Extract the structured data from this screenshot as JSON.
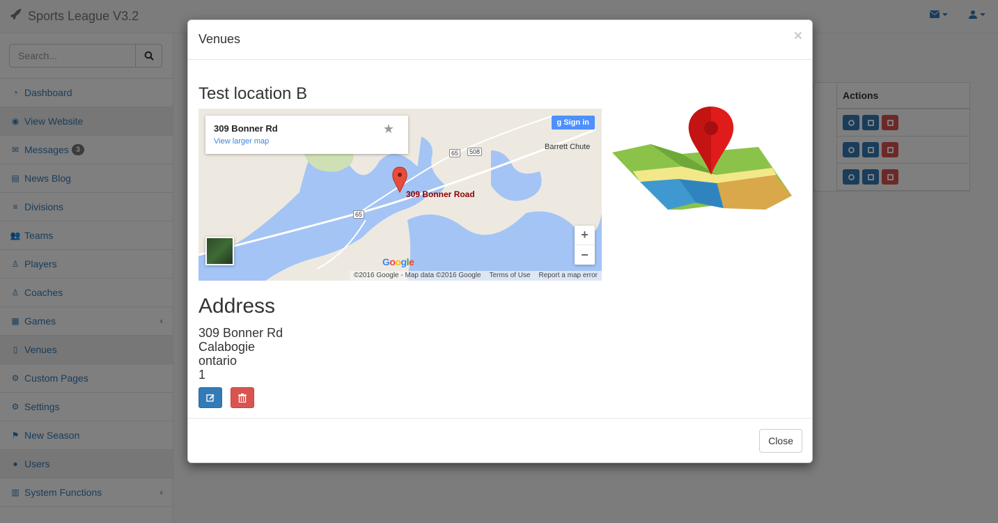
{
  "app": {
    "brand": "Sports League V3.2"
  },
  "navbar": {
    "messages_icon": "envelope-icon",
    "user_icon": "user-icon"
  },
  "sidebar": {
    "search_placeholder": "Search...",
    "items": [
      {
        "label": "Dashboard",
        "icon": "dashboard-icon"
      },
      {
        "label": "View Website",
        "icon": "eye-icon"
      },
      {
        "label": "Messages",
        "icon": "envelope-icon",
        "badge": "3"
      },
      {
        "label": "News Blog",
        "icon": "newspaper-icon"
      },
      {
        "label": "Divisions",
        "icon": "list-icon"
      },
      {
        "label": "Teams",
        "icon": "users-icon"
      },
      {
        "label": "Players",
        "icon": "player-icon"
      },
      {
        "label": "Coaches",
        "icon": "coach-icon"
      },
      {
        "label": "Games",
        "icon": "calendar-icon"
      },
      {
        "label": "Venues",
        "icon": "building-icon"
      },
      {
        "label": "Custom Pages",
        "icon": "cogs-icon"
      },
      {
        "label": "Settings",
        "icon": "gear-icon"
      },
      {
        "label": "New Season",
        "icon": "flag-icon"
      },
      {
        "label": "Users",
        "icon": "user-icon"
      },
      {
        "label": "System Functions",
        "icon": "bar-chart-icon"
      }
    ]
  },
  "table": {
    "actions_header": "Actions",
    "rows": 3
  },
  "modal": {
    "title": "Venues",
    "close_x": "×",
    "venue_name": "Test location B",
    "map": {
      "card_address": "309 Bonner Rd",
      "card_link": "View larger map",
      "sign_in": "Sign in",
      "place_label": "Barrett Chute",
      "marker_label": "309 Bonner Road",
      "road_65": "65",
      "road_508": "508",
      "zoom_in": "+",
      "zoom_out": "−",
      "logo": "Google",
      "footer_copyright": "©2016 Google - Map data ©2016 Google",
      "footer_terms": "Terms of Use",
      "footer_report": "Report a map error"
    },
    "address_title": "Address",
    "address": {
      "street": "309 Bonner Rd",
      "city": "Calabogie",
      "province": "ontario",
      "postal": "1"
    },
    "close_button": "Close"
  }
}
